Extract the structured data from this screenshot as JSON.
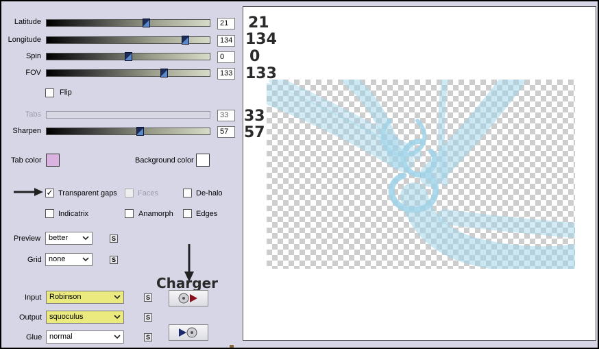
{
  "sliders": [
    {
      "label": "Latitude",
      "value": "21",
      "fill": 0.61
    },
    {
      "label": "Longitude",
      "value": "134",
      "fill": 0.85
    },
    {
      "label": "Spin",
      "value": "0",
      "fill": 0.5
    },
    {
      "label": "FOV",
      "value": "133",
      "fill": 0.72
    }
  ],
  "flip": {
    "label": "Flip",
    "checked": false
  },
  "tabs": {
    "label": "Tabs",
    "value": "33"
  },
  "sharpen": {
    "label": "Sharpen",
    "value": "57",
    "fill": 0.57
  },
  "tab_color": {
    "label": "Tab color",
    "color": "#d9b2e0"
  },
  "background_color": {
    "label": "Background color",
    "color": "#ffffff"
  },
  "options": {
    "transparent_gaps": {
      "label": "Transparent gaps",
      "checked": true
    },
    "faces": {
      "label": "Faces",
      "checked": false,
      "disabled": true
    },
    "de_halo": {
      "label": "De-halo",
      "checked": false
    },
    "indicatrix": {
      "label": "Indicatrix",
      "checked": false
    },
    "anamorph": {
      "label": "Anamorph",
      "checked": false
    },
    "edges": {
      "label": "Edges",
      "checked": false
    }
  },
  "preview": {
    "label": "Preview",
    "value": "better"
  },
  "grid": {
    "label": "Grid",
    "value": "none"
  },
  "input": {
    "label": "Input",
    "value": "Robinson"
  },
  "output": {
    "label": "Output",
    "value": "squoculus"
  },
  "glue": {
    "label": "Glue",
    "value": "normal"
  },
  "s_button_label": "S",
  "annotations": {
    "lat": "21",
    "lon": "134",
    "spin": "0",
    "fov": "133",
    "tabs": "33",
    "sharpen": "57",
    "charger": "Charger"
  },
  "colors": {
    "panel": "#d6d6e6",
    "accent_yellow": "#eaea7e",
    "swirl": "#9fd4ea"
  }
}
